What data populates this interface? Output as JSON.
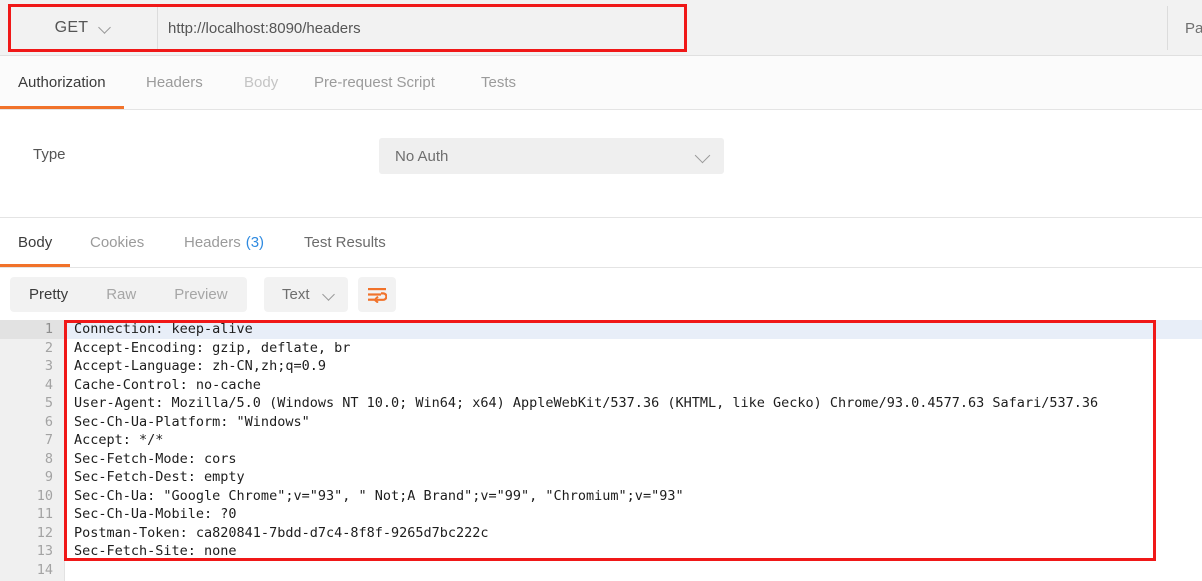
{
  "request_bar": {
    "method": "GET",
    "method_caret_icon": "chevron-down-icon",
    "url": "http://localhost:8090/headers",
    "params_label": "Pa"
  },
  "request_tabs": [
    {
      "label": "Authorization",
      "state": "active"
    },
    {
      "label": "Headers",
      "state": "normal"
    },
    {
      "label": "Body",
      "state": "disabled"
    },
    {
      "label": "Pre-request Script",
      "state": "normal"
    },
    {
      "label": "Tests",
      "state": "normal"
    }
  ],
  "auth_panel": {
    "type_label": "Type",
    "type_value": "No Auth",
    "caret_icon": "chevron-down-icon"
  },
  "response_tabs": [
    {
      "label": "Body",
      "state": "active",
      "count": ""
    },
    {
      "label": "Cookies",
      "state": "normal",
      "count": ""
    },
    {
      "label": "Headers",
      "state": "normal",
      "count": "(3)"
    },
    {
      "label": "Test Results",
      "state": "dark",
      "count": ""
    }
  ],
  "view_toolbar": {
    "segments": [
      {
        "label": "Pretty",
        "state": "active"
      },
      {
        "label": "Raw",
        "state": "inactive"
      },
      {
        "label": "Preview",
        "state": "inactive"
      }
    ],
    "format_value": "Text",
    "format_caret_icon": "chevron-down-icon",
    "wrap_icon": "word-wrap-icon"
  },
  "body": {
    "line_numbers": [
      "1",
      "2",
      "3",
      "4",
      "5",
      "6",
      "7",
      "8",
      "9",
      "10",
      "11",
      "12",
      "13",
      "14"
    ],
    "current_line": 1,
    "lines": [
      "Connection: keep-alive",
      "Accept-Encoding: gzip, deflate, br",
      "Accept-Language: zh-CN,zh;q=0.9",
      "Cache-Control: no-cache",
      "User-Agent: Mozilla/5.0 (Windows NT 10.0; Win64; x64) AppleWebKit/537.36 (KHTML, like Gecko) Chrome/93.0.4577.63 Safari/537.36",
      "Sec-Ch-Ua-Platform: \"Windows\"",
      "Accept: */*",
      "Sec-Fetch-Mode: cors",
      "Sec-Fetch-Dest: empty",
      "Sec-Ch-Ua: \"Google Chrome\";v=\"93\", \" Not;A Brand\";v=\"99\", \"Chromium\";v=\"93\"",
      "Sec-Ch-Ua-Mobile: ?0",
      "Postman-Token: ca820841-7bdd-d7c4-8f8f-9265d7bc222c",
      "Sec-Fetch-Site: none",
      ""
    ]
  },
  "annotations": {
    "highlight_color": "#f01818",
    "accent_color": "#f1722a",
    "count_color": "#2f8ae0"
  }
}
